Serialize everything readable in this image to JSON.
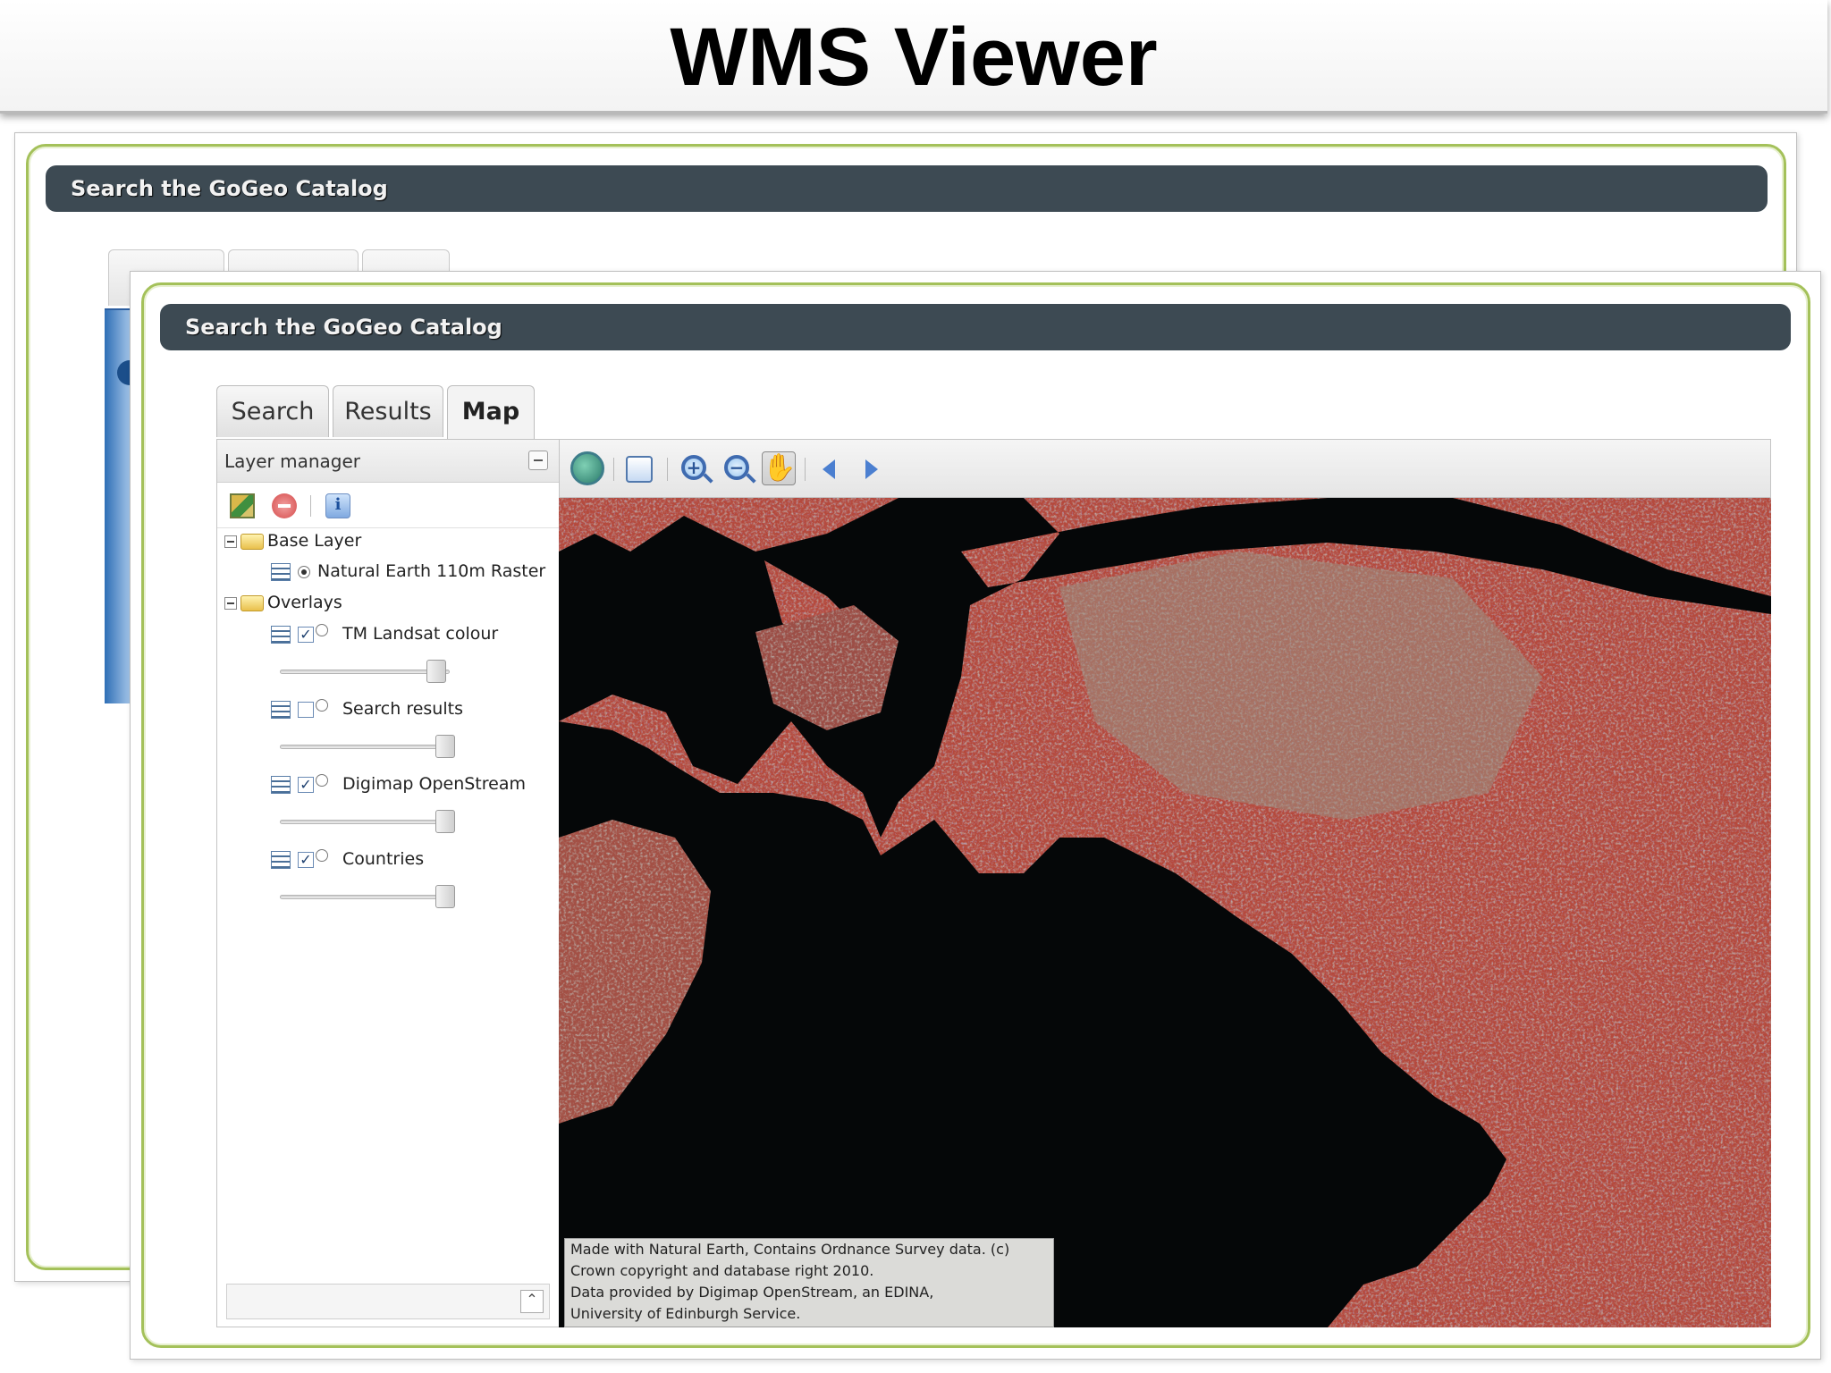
{
  "slide": {
    "title": "WMS Viewer"
  },
  "window": {
    "title": "Search the GoGeo Catalog"
  },
  "tabs": [
    {
      "label": "Search",
      "active": false
    },
    {
      "label": "Results",
      "active": false
    },
    {
      "label": "Map",
      "active": true
    }
  ],
  "layer_manager": {
    "title": "Layer manager",
    "toolbar_icons": [
      "add-layer-icon",
      "remove-layer-icon",
      "layer-info-icon"
    ],
    "groups": [
      {
        "name": "Base Layer",
        "layers": [
          {
            "name": "Natural Earth 110m Raster",
            "selected": true
          }
        ]
      },
      {
        "name": "Overlays",
        "layers": [
          {
            "name": "TM Landsat colour",
            "visible": true,
            "opacity_pct": 95
          },
          {
            "name": "Search results",
            "visible": false,
            "opacity_pct": 100
          },
          {
            "name": "Digimap OpenStream",
            "visible": true,
            "opacity_pct": 100
          },
          {
            "name": "Countries",
            "visible": true,
            "opacity_pct": 100
          }
        ]
      }
    ]
  },
  "map_toolbar": {
    "tools": [
      "zoom-to-max-extent-icon",
      "zoom-box-icon",
      "zoom-in-icon",
      "zoom-out-icon",
      "pan-hand-icon",
      "previous-view-icon",
      "next-view-icon"
    ],
    "active_tool": "pan-hand-icon"
  },
  "map": {
    "attribution": "Made with Natural Earth, Contains Ordnance Survey data. (c)\nCrown copyright and database right 2010.\nData provided by Digimap OpenStream, an EDINA,\nUniversity of Edinburgh Service.",
    "colors": {
      "land": "#b94a3a",
      "water": "#050708",
      "vegetation": "#8fb9a6"
    }
  }
}
